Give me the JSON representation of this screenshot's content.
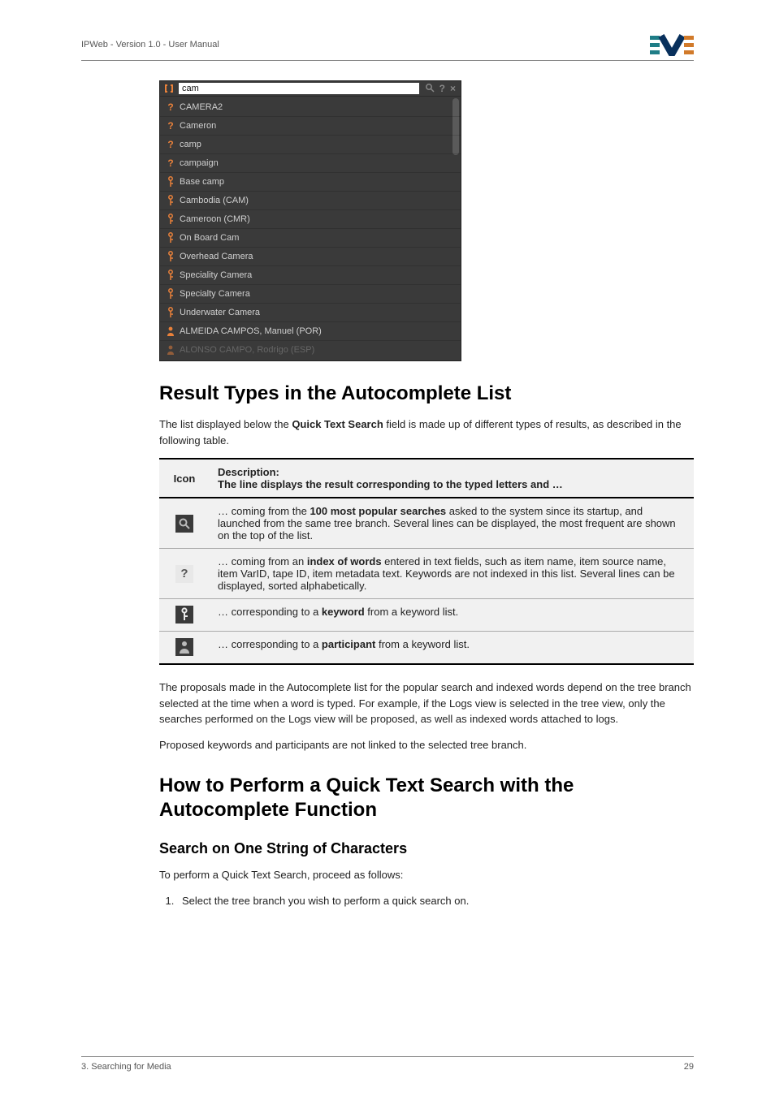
{
  "header": {
    "doc_title": "IPWeb - Version 1.0 - User Manual"
  },
  "footer": {
    "chapter": "3. Searching for Media",
    "page": "29"
  },
  "autocomplete": {
    "query": "cam",
    "items": [
      {
        "icon": "q",
        "label": "CAMERA2"
      },
      {
        "icon": "q",
        "label": "Cameron"
      },
      {
        "icon": "q",
        "label": "camp"
      },
      {
        "icon": "q",
        "label": "campaign"
      },
      {
        "icon": "kw",
        "label": "Base camp"
      },
      {
        "icon": "kw",
        "label": "Cambodia (CAM)"
      },
      {
        "icon": "kw",
        "label": "Cameroon (CMR)"
      },
      {
        "icon": "kw",
        "label": "On Board Cam"
      },
      {
        "icon": "kw",
        "label": "Overhead Camera"
      },
      {
        "icon": "kw",
        "label": "Speciality Camera"
      },
      {
        "icon": "kw",
        "label": "Specialty Camera"
      },
      {
        "icon": "kw",
        "label": "Underwater Camera"
      },
      {
        "icon": "pp",
        "label": "ALMEIDA CAMPOS, Manuel (POR)"
      },
      {
        "icon": "pp",
        "label": "ALONSO CAMPO, Rodrigo (ESP)",
        "fade": true
      }
    ]
  },
  "section1": {
    "heading": "Result Types in the Autocomplete List",
    "intro_pre": "The list displayed below the ",
    "intro_bold": "Quick Text Search",
    "intro_post": " field is made up of different types of results, as described in the following table."
  },
  "table": {
    "head_icon": "Icon",
    "head_desc_label": "Description:",
    "head_desc_sub": "The line displays the result corresponding to the typed letters and …",
    "rows": [
      {
        "icon": "magnifier",
        "pre": "… coming from the ",
        "bold": "100 most popular searches",
        "post": " asked to the system since its startup, and launched from the same tree branch. Several lines can be displayed, the most frequent are shown on the top of the list."
      },
      {
        "icon": "question",
        "pre": "… coming from an ",
        "bold": "index of words",
        "post": " entered in text fields, such as item name, item source name, item VarID, tape ID, item metadata text. Keywords are not indexed in this list. Several lines can be displayed, sorted alphabetically."
      },
      {
        "icon": "keyword",
        "pre": "… corresponding to a ",
        "bold": "keyword",
        "post": " from a keyword list."
      },
      {
        "icon": "participant",
        "pre": "… corresponding to a ",
        "bold": "participant",
        "post": " from a keyword list."
      }
    ]
  },
  "para_after_table": "The proposals made in the Autocomplete list for the popular search and indexed words depend on the tree branch selected at the time when a word is typed. For example, if the Logs view is selected in the tree view, only the searches performed on the Logs view will be proposed, as well as indexed words attached to logs.",
  "para_after_table2": "Proposed keywords and participants are not linked to the selected tree branch.",
  "section2": {
    "heading": "How to Perform a Quick Text Search with the Autocomplete Function",
    "subheading": "Search on One String of Characters",
    "intro": "To perform a Quick Text Search, proceed as follows:",
    "step1": "Select the tree branch you wish to perform a quick search on."
  }
}
